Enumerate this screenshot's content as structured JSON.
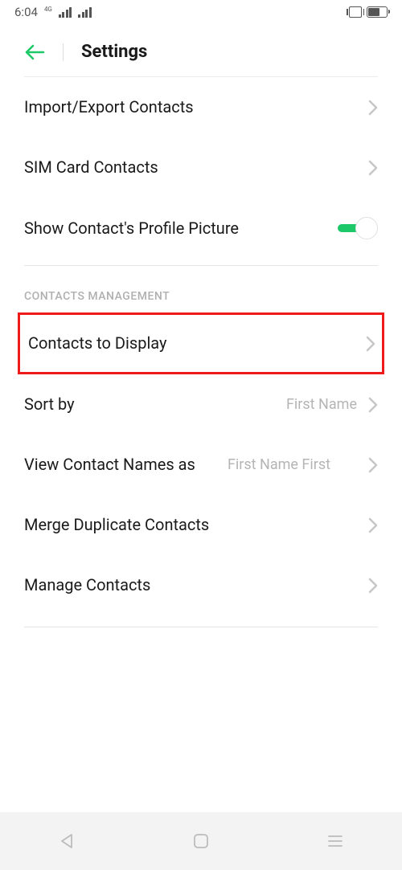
{
  "status": {
    "time": "6:04",
    "network_label": "4G"
  },
  "header": {
    "title": "Settings"
  },
  "rows": {
    "import_export": "Import/Export Contacts",
    "sim_card": "SIM Card Contacts",
    "profile_picture": "Show Contact's Profile Picture",
    "profile_picture_toggle": true
  },
  "section": {
    "management_header": "CONTACTS MANAGEMENT",
    "contacts_to_display": "Contacts to Display",
    "sort_by": "Sort by",
    "sort_by_value": "First Name",
    "view_names_as": "View Contact Names as",
    "view_names_as_value": "First Name First",
    "merge_duplicates": "Merge Duplicate Contacts",
    "manage_contacts": "Manage Contacts"
  }
}
